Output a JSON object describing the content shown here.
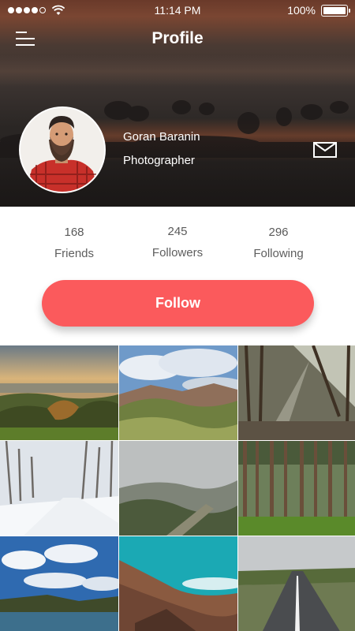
{
  "status_bar": {
    "time": "11:14 PM",
    "battery_percent": "100%",
    "signal_strength": 4,
    "signal_bars_total": 5
  },
  "header": {
    "title": "Profile",
    "menu_icon": "hamburger-menu-icon"
  },
  "profile": {
    "name": "Goran Baranin",
    "role": "Photographer",
    "message_icon": "mail-icon"
  },
  "stats": [
    {
      "value": "168",
      "label": "Friends"
    },
    {
      "value": "245",
      "label": "Followers"
    },
    {
      "value": "296",
      "label": "Following"
    }
  ],
  "follow_button": {
    "label": "Follow"
  },
  "colors": {
    "accent": "#fb5a5c",
    "text": "#5a5a5a",
    "header_overlay": "#231f1e"
  },
  "gallery": [
    {
      "name": "photo-coast-town"
    },
    {
      "name": "photo-mountain-valley"
    },
    {
      "name": "photo-sunlit-forest"
    },
    {
      "name": "photo-snowy-road"
    },
    {
      "name": "photo-foggy-hills"
    },
    {
      "name": "photo-pine-forest"
    },
    {
      "name": "photo-lake-clouds"
    },
    {
      "name": "photo-red-hills"
    },
    {
      "name": "photo-open-road"
    }
  ]
}
